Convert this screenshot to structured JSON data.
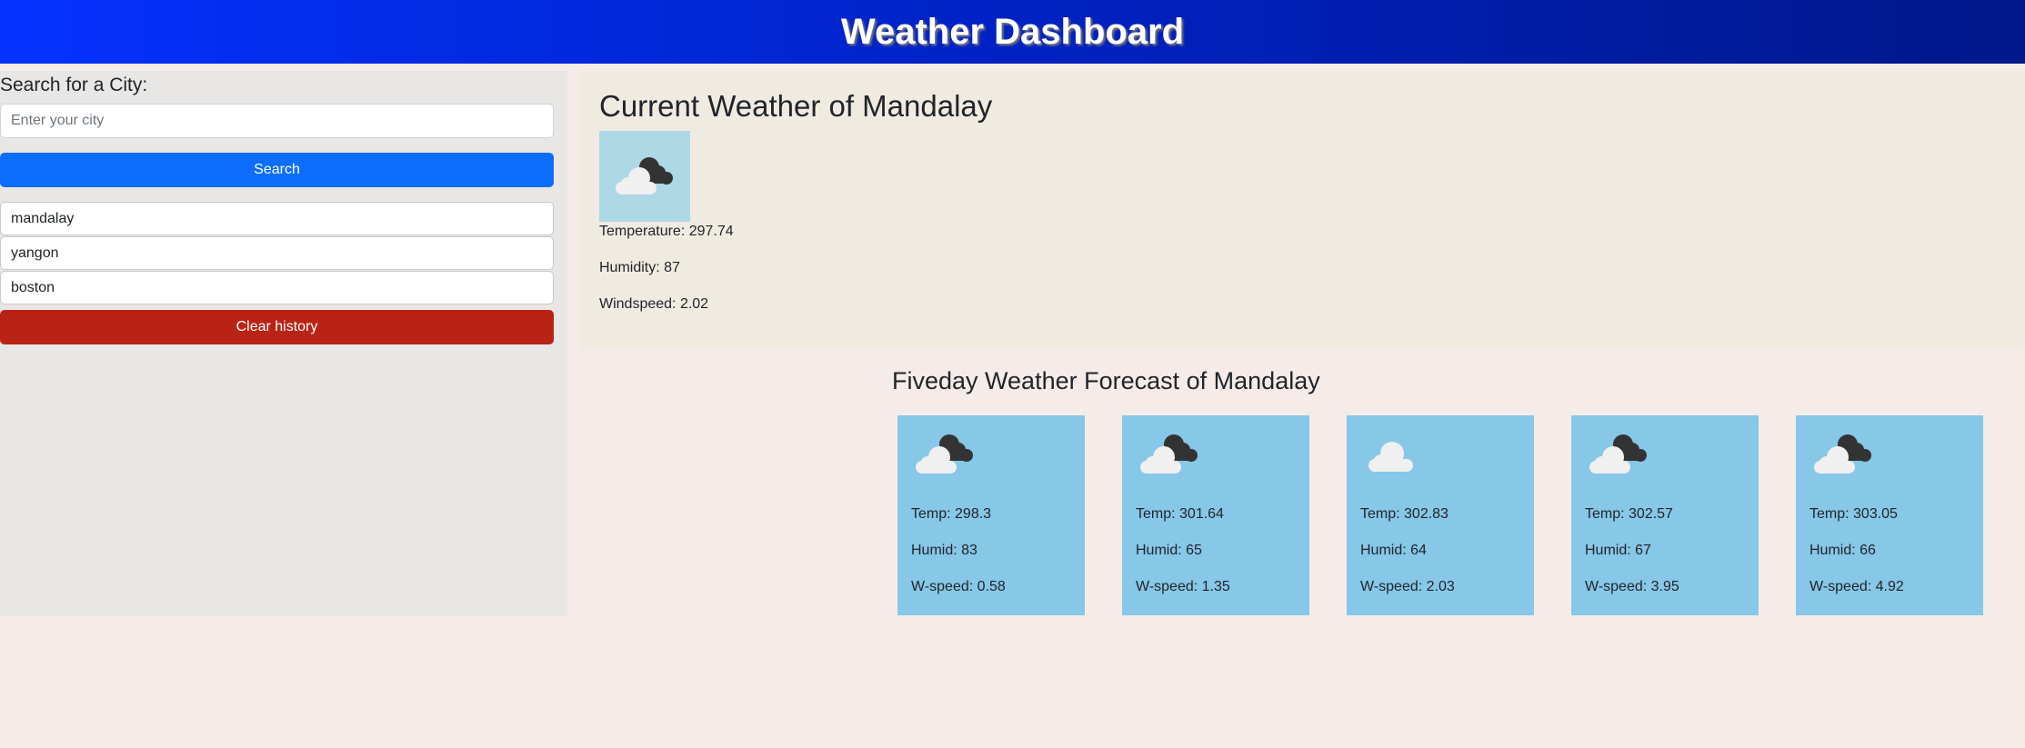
{
  "header": {
    "title": "Weather Dashboard"
  },
  "sidebar": {
    "search_label": "Search for a City:",
    "input_placeholder": "Enter your city",
    "search_button": "Search",
    "history": [
      "mandalay",
      "yangon",
      "boston"
    ],
    "clear_button": "Clear history"
  },
  "current": {
    "title": "Current Weather of Mandalay",
    "icon": "clouds-icon",
    "temperature": "Temperature: 297.74",
    "humidity": "Humidity: 87",
    "windspeed": "Windspeed: 2.02"
  },
  "forecast": {
    "title": "Fiveday Weather Forecast of Mandalay",
    "days": [
      {
        "icon": "broken-clouds-icon",
        "temp": "Temp: 298.3",
        "humid": "Humid: 83",
        "wspeed": "W-speed: 0.58"
      },
      {
        "icon": "broken-clouds-icon",
        "temp": "Temp: 301.64",
        "humid": "Humid: 65",
        "wspeed": "W-speed: 1.35"
      },
      {
        "icon": "cloud-icon",
        "temp": "Temp: 302.83",
        "humid": "Humid: 64",
        "wspeed": "W-speed: 2.03"
      },
      {
        "icon": "broken-clouds-icon",
        "temp": "Temp: 302.57",
        "humid": "Humid: 67",
        "wspeed": "W-speed: 3.95"
      },
      {
        "icon": "broken-clouds-icon",
        "temp": "Temp: 303.05",
        "humid": "Humid: 66",
        "wspeed": "W-speed: 4.92"
      }
    ]
  },
  "colors": {
    "header_gradient_start": "#0432ff",
    "header_gradient_end": "#00188a",
    "search_button": "#0d6efd",
    "clear_button": "#b92316",
    "forecast_card": "#87c7e7",
    "current_icon_bg": "#add8e6"
  }
}
